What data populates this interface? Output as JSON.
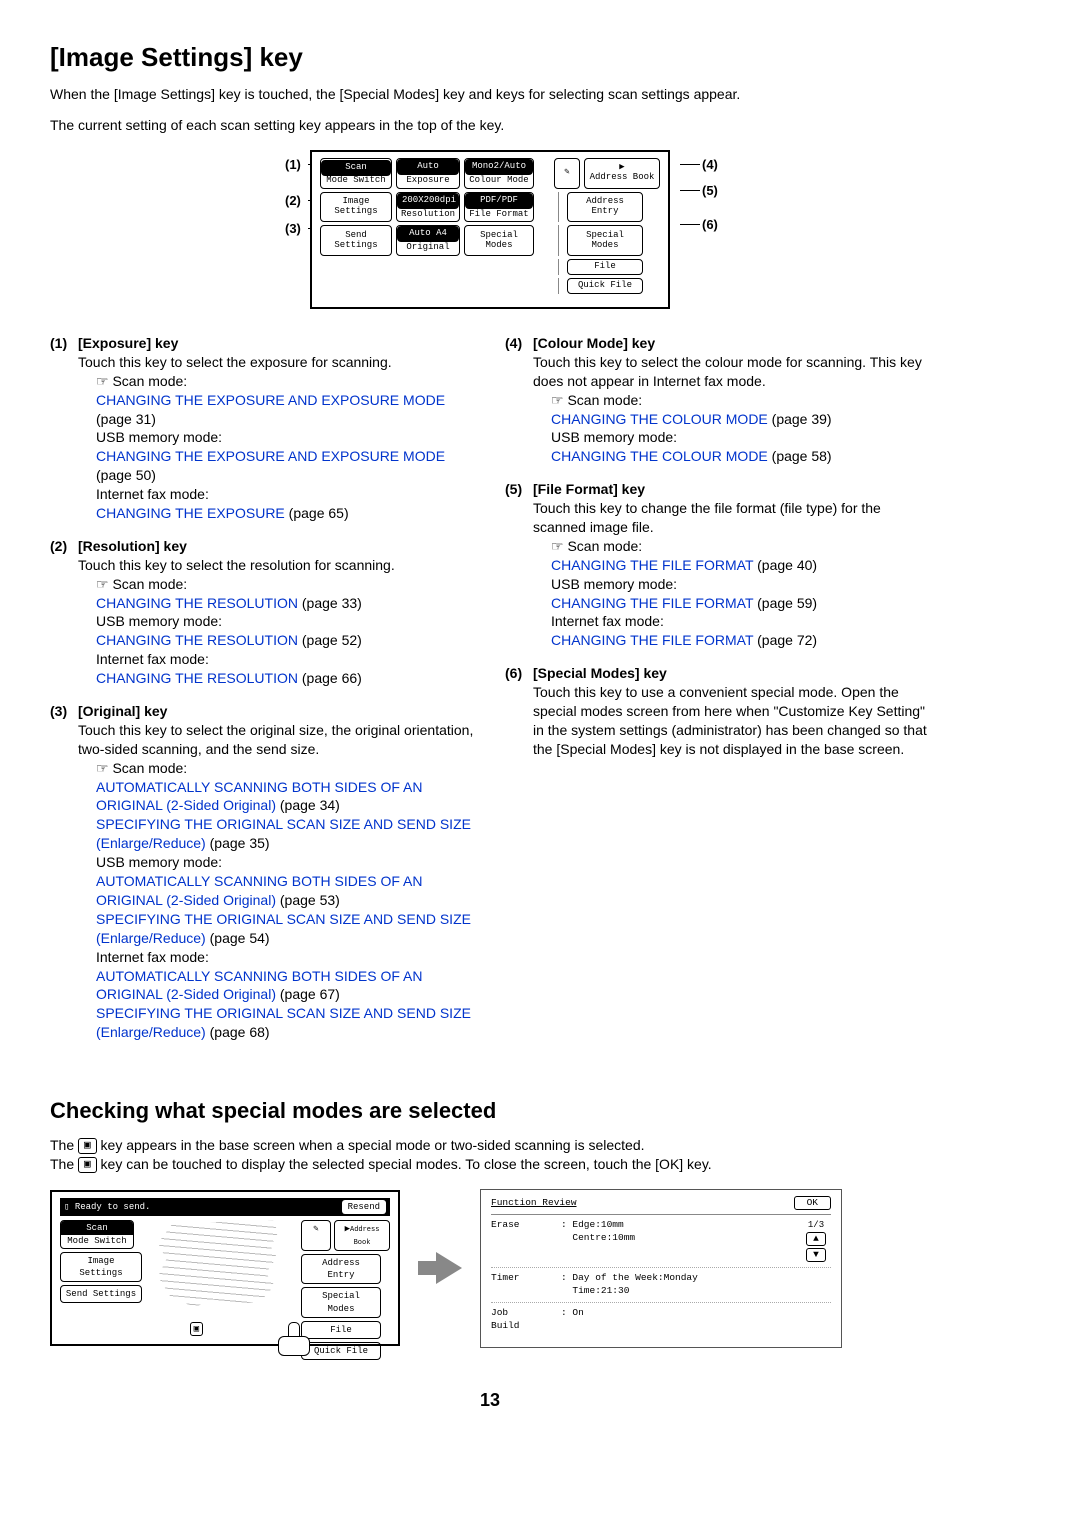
{
  "title": "[Image Settings] key",
  "intro1": "When the [Image Settings] key is touched, the [Special Modes] key and keys for selecting scan settings appear.",
  "intro2": "The current setting of each scan setting key appears in the top of the key.",
  "diagram": {
    "scan": "Scan",
    "mode_switch": "Mode Switch",
    "image_settings": "Image\nSettings",
    "send_settings": "Send Settings",
    "auto": "Auto",
    "exposure": "Exposure",
    "resolution_val": "200X200dpi",
    "resolution": "Resolution",
    "original_val": "Auto   A4",
    "original": "Original",
    "colour_val": "Mono2/Auto",
    "colour": "Colour Mode",
    "file_val": "PDF/PDF",
    "file": "File Format",
    "special": "Special Modes",
    "address_book": "Address Book",
    "address_entry": "Address Entry",
    "special_modes_r": "Special Modes",
    "file_r": "File",
    "quick_file": "Quick File"
  },
  "callouts": {
    "c1": "(1)",
    "c2": "(2)",
    "c3": "(3)",
    "c4": "(4)",
    "c5": "(5)",
    "c6": "(6)"
  },
  "left": [
    {
      "num": "(1)",
      "title": "[Exposure] key",
      "desc": "Touch this key to select the exposure for scanning.",
      "lines": [
        {
          "prefix": "☞ Scan mode:"
        },
        {
          "link": "CHANGING THE EXPOSURE AND EXPOSURE MODE",
          "after": " (page 31)"
        },
        {
          "prefix": "USB memory mode:"
        },
        {
          "link": "CHANGING THE EXPOSURE AND EXPOSURE MODE",
          "after": " (page 50)"
        },
        {
          "prefix": "Internet fax mode:"
        },
        {
          "link": "CHANGING THE EXPOSURE",
          "after": " (page 65)"
        }
      ]
    },
    {
      "num": "(2)",
      "title": "[Resolution] key",
      "desc": "Touch this key to select the resolution for scanning.",
      "lines": [
        {
          "prefix": "☞ Scan mode:"
        },
        {
          "link": "CHANGING THE RESOLUTION",
          "after": " (page 33)"
        },
        {
          "prefix": "USB memory mode:"
        },
        {
          "link": "CHANGING THE RESOLUTION",
          "after": " (page 52)"
        },
        {
          "prefix": "Internet fax mode:"
        },
        {
          "link": "CHANGING THE RESOLUTION",
          "after": " (page 66)"
        }
      ]
    },
    {
      "num": "(3)",
      "title": "[Original] key",
      "desc": "Touch this key to select the original size, the original orientation, two-sided scanning, and the send size.",
      "lines": [
        {
          "prefix": "☞ Scan mode:"
        },
        {
          "link": "AUTOMATICALLY SCANNING BOTH SIDES OF AN ORIGINAL (2-Sided Original)",
          "after": " (page 34)"
        },
        {
          "link": "SPECIFYING THE ORIGINAL SCAN SIZE AND SEND SIZE (Enlarge/Reduce)",
          "after": " (page 35)"
        },
        {
          "prefix": "USB memory mode:"
        },
        {
          "link": "AUTOMATICALLY SCANNING BOTH SIDES OF AN ORIGINAL (2-Sided Original)",
          "after": " (page 53)"
        },
        {
          "link": "SPECIFYING THE ORIGINAL SCAN SIZE AND SEND SIZE (Enlarge/Reduce)",
          "after": " (page 54)"
        },
        {
          "prefix": "Internet fax mode:"
        },
        {
          "link": "AUTOMATICALLY SCANNING BOTH SIDES OF AN ORIGINAL (2-Sided Original)",
          "after": " (page 67)"
        },
        {
          "link": "SPECIFYING THE ORIGINAL SCAN SIZE AND SEND SIZE (Enlarge/Reduce)",
          "after": " (page 68)"
        }
      ]
    }
  ],
  "right": [
    {
      "num": "(4)",
      "title": "[Colour Mode] key",
      "desc": "Touch this key to select the colour mode for scanning. This key does not appear in Internet fax mode.",
      "lines": [
        {
          "prefix": "☞ Scan mode:"
        },
        {
          "link": "CHANGING THE COLOUR MODE",
          "after": " (page 39)"
        },
        {
          "prefix": "USB memory mode:"
        },
        {
          "link": "CHANGING THE COLOUR MODE",
          "after": " (page 58)"
        }
      ]
    },
    {
      "num": "(5)",
      "title": "[File Format] key",
      "desc": "Touch this key to change the file format (file type) for the scanned image file.",
      "lines": [
        {
          "prefix": "☞ Scan mode:"
        },
        {
          "link": "CHANGING THE FILE FORMAT",
          "after": " (page 40)"
        },
        {
          "prefix": "USB memory mode:"
        },
        {
          "link": "CHANGING THE FILE FORMAT",
          "after": " (page 59)"
        },
        {
          "prefix": "Internet fax mode:"
        },
        {
          "link": "CHANGING THE FILE FORMAT",
          "after": " (page 72)"
        }
      ]
    },
    {
      "num": "(6)",
      "title": "[Special Modes] key",
      "desc": "Touch this key to use a convenient special mode. Open the special modes screen from here when \"Customize Key Setting\" in the system settings (administrator) has been changed so that the [Special Modes] key is not displayed in the base screen.",
      "lines": []
    }
  ],
  "section2_title": "Checking what special modes are selected",
  "section2_l1a": "The ",
  "section2_l1b": " key appears in the base screen when a special mode or two-sided scanning is selected.",
  "section2_l2a": "The ",
  "section2_l2b": " key can be touched to display the selected special modes. To close the screen, touch the [OK] key.",
  "icon_glyph": "⫾",
  "panelA": {
    "status": "Ready to send.",
    "resend": "Resend",
    "scan": "Scan",
    "mode_switch": "Mode Switch",
    "image_settings": "Image\nSettings",
    "send_settings": "Send Settings",
    "address_book": "Address Book",
    "address_entry": "Address Entry",
    "special_modes": "Special Modes",
    "file": "File",
    "quick_file": "Quick File"
  },
  "panelB": {
    "title": "Function Review",
    "ok": "OK",
    "page": "1/3",
    "rows": [
      {
        "l": "Erase",
        "c": ": Edge:10mm\n  Centre:10mm"
      },
      {
        "l": "Timer",
        "c": ": Day of the Week:Monday\n  Time:21:30"
      },
      {
        "l": "Job\nBuild",
        "c": ": On"
      }
    ],
    "up": "✦",
    "down": "✦"
  },
  "page_number": "13"
}
